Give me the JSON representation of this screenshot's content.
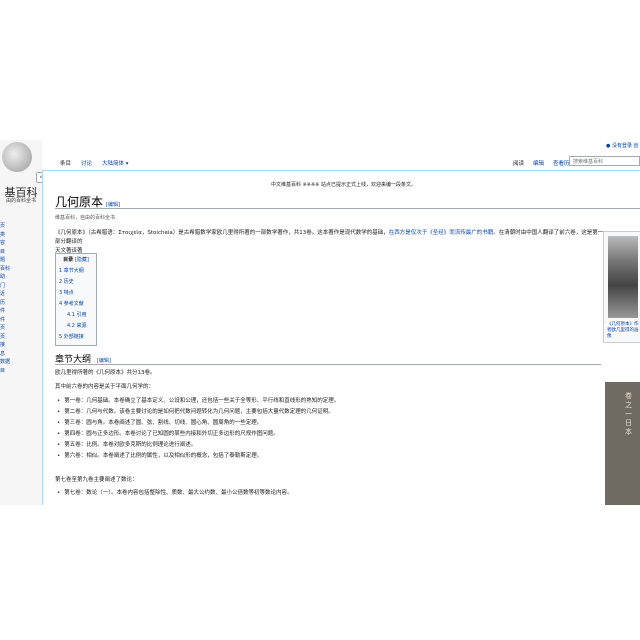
{
  "sidebar": {
    "logo_title": "基百科",
    "logo_subtitle": "由的百科全书",
    "collapse_glyph": "«",
    "links": [
      "页",
      "类",
      "容",
      "目",
      "题",
      "百科",
      "",
      "",
      "",
      "",
      "助",
      "门",
      "近",
      "历",
      "件",
      "",
      "",
      "",
      "",
      "",
      "件",
      "页",
      "页",
      "接",
      "息",
      "数据",
      "目"
    ]
  },
  "personal": {
    "tools": "没有登录 创"
  },
  "tabs": {
    "left": [
      "条目",
      "讨论",
      "大陆简体 ▾"
    ],
    "right": [
      "阅读",
      "编辑",
      "查看历史"
    ]
  },
  "search": {
    "placeholder": "搜索维基百科"
  },
  "notice": "中文维基百科 ※※※※ 站点已提示正式上线，欢迎来编一段条文。",
  "page": {
    "title": "几何原本",
    "title_edit": "[编辑]",
    "source": "维基百科，自由的百科全书",
    "intro_1": "《几何原本》（古希腊语：Στοιχεῖα，Stoicheia）是古希腊数学家欧几里得所著的一部数学著作，共13卷。这本著作是现代数学的基础，",
    "intro_link_1": "在西方是仅次于《圣经》而流传最广的书籍",
    "intro_2": "。在清朝时由中国人翻译了前六卷，这是第一部分翻译的",
    "intro_3": "天文著译著"
  },
  "toc": {
    "title": "目录",
    "toggle": "[隐藏]",
    "items": [
      {
        "num": "1",
        "text": "章节大纲",
        "sub": false
      },
      {
        "num": "2",
        "text": "历史",
        "sub": false
      },
      {
        "num": "3",
        "text": "特点",
        "sub": false
      },
      {
        "num": "4",
        "text": "参考文献",
        "sub": false
      },
      {
        "num": "4.1",
        "text": "引用",
        "sub": true
      },
      {
        "num": "4.2",
        "text": "来源",
        "sub": true
      },
      {
        "num": "5",
        "text": "外部链接",
        "sub": false
      }
    ]
  },
  "section": {
    "heading": "章节大纲",
    "edit": "[编辑]",
    "para1": "欧几里得所著的《几何原本》共分13卷。",
    "para2": "其中前六卷的内容是关于平面几何学的：",
    "list1": [
      "第一卷：几何基础。本卷确立了基本定义、公设和公理，还包括一些关于全等形、平行线和直线形的熟知的定理。",
      "第二卷：几何与代数。该卷主要讨论的是如何把代数问题转化为几何问题，主要包括大量代数定理的几何证明。",
      "第三卷：圆与角。本卷阐述了圆、弦、割线、切线、圆心角、圆周角的一些定理。",
      "第四卷：圆与正多边形。本卷讨论了已知圆的某些内接和外切正多边形的尺规作图问题。",
      "第五卷：比例。本卷对欧多克斯的比例理论进行阐述。",
      "第六卷：相似。本卷阐述了比例的属性，以及相似形的概念，包括了泰勒斯定理。"
    ],
    "para3": "第七卷至第九卷主要阐述了数论：",
    "list2": [
      "第七卷：数论（一）。本卷内容包括整除性、质数、最大公约数、最小公倍数等初等数论内容。"
    ]
  },
  "images": {
    "caption1": "《几何原本》作者欧几里得的画像",
    "caption2_text": "卷之一日本"
  }
}
